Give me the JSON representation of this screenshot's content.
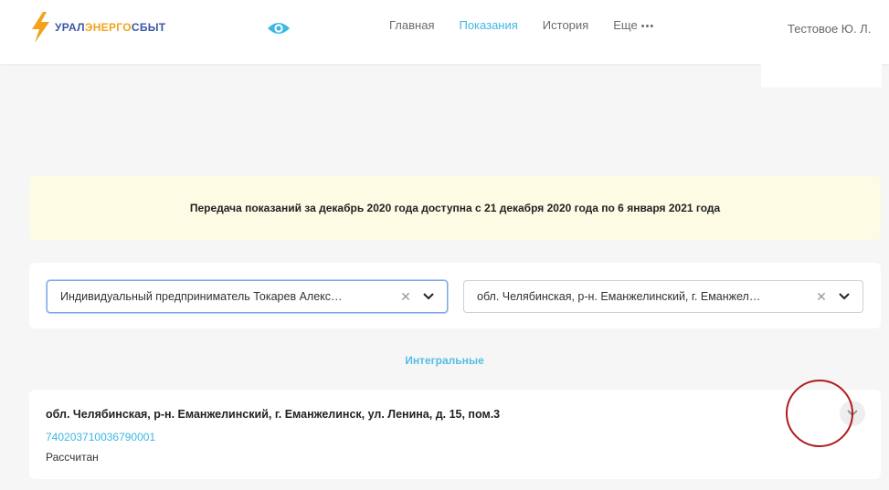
{
  "header": {
    "logo": {
      "prefix": "УРАЛ",
      "mid": "ЭНЕРГО",
      "suffix": "СБЫТ",
      "icon": "lightning-bolt-icon",
      "brand_color": "#3b59a3",
      "accent_color": "#f2a31b"
    },
    "visibility_icon": "eye-icon",
    "nav": [
      {
        "label": "Главная",
        "active": false
      },
      {
        "label": "Показания",
        "active": true
      },
      {
        "label": "История",
        "active": false
      }
    ],
    "more": {
      "label": "Еще",
      "dots": "•••"
    },
    "user": "Тестовое Ю. Л."
  },
  "banner": {
    "text": "Передача показаний за декабрь 2020 года доступна с 21 декабря 2020 года по 6 января 2021 года",
    "background": "#fdfbe3"
  },
  "filters": {
    "client": {
      "value": "Индивидуальный предприниматель Токарев Алекс…",
      "clear_icon": "close-icon",
      "toggle_icon": "chevron-down-icon"
    },
    "address": {
      "value": "обл. Челябинская, р-н. Еманжелинский, г. Еманжел…",
      "clear_icon": "close-icon",
      "toggle_icon": "chevron-down-icon"
    }
  },
  "section": {
    "label": "Интегральные"
  },
  "account": {
    "address": "обл. Челябинская, р-н. Еманжелинский, г. Еманжелинск, ул. Ленина, д. 15, пом.3",
    "number": "740203710036790001",
    "status": "Рассчитан",
    "expand_icon": "chevron-down-icon"
  },
  "colors": {
    "accent": "#3db7e4",
    "annotation": "#b01c1c",
    "page_bg": "#f6f6f6"
  }
}
